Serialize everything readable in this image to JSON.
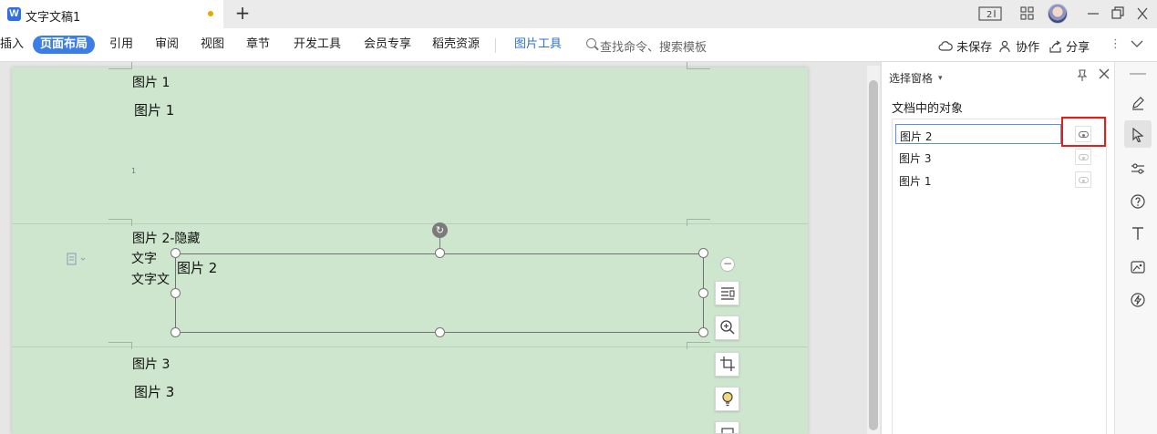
{
  "titlebar": {
    "app_logo": "W",
    "doc_title": "文字文稿1",
    "new_tab": "+",
    "icons": [
      "layout-2-icon",
      "grid-icon",
      "avatar",
      "minimize-icon",
      "restore-icon",
      "close-icon"
    ]
  },
  "ribbon": {
    "tabs": [
      "插入",
      "页面布局",
      "引用",
      "审阅",
      "视图",
      "章节",
      "开发工具",
      "会员专享",
      "稻壳资源"
    ],
    "active_tab": "页面布局",
    "tool_tab": "图片工具",
    "search_placeholder": "查找命令、搜索模板",
    "unsaved": "未保存",
    "collab": "协作",
    "share": "分享"
  },
  "document": {
    "p1_label": "图片 1",
    "p1_caption": "图片 1",
    "p1_mark": "1",
    "p2_label": "图片 2-隐藏",
    "p2_text1": "文字",
    "p2_text2": "文字文",
    "p2_caption": "图片 2",
    "p3_label": "图片 3",
    "p3_caption": "图片 3"
  },
  "selection_pane": {
    "title": "选择窗格",
    "subtitle": "文档中的对象",
    "objects": [
      {
        "name": "图片 2",
        "selected": true,
        "visible": true
      },
      {
        "name": "图片 3",
        "selected": false,
        "visible": true
      },
      {
        "name": "图片 1",
        "selected": false,
        "visible": true
      }
    ]
  },
  "right_toolbar": {
    "tools": [
      "pen-icon",
      "cursor-icon",
      "sliders-icon",
      "help-icon",
      "text-icon",
      "image-edit-icon",
      "bolt-icon"
    ],
    "active": "cursor-icon"
  },
  "colors": {
    "accent": "#3c7ee6",
    "page": "#cde6cd",
    "highlight": "#e0201a"
  }
}
